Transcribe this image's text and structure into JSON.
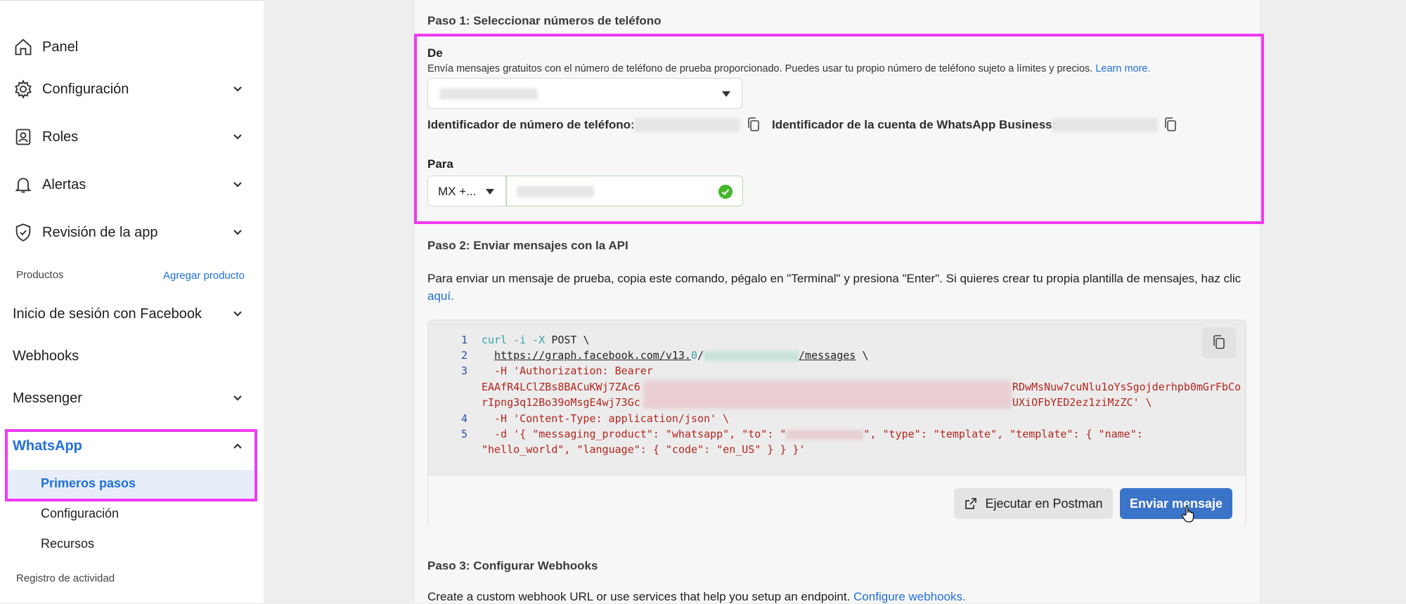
{
  "sidebar": {
    "panel": "Panel",
    "configuracion": "Configuración",
    "roles": "Roles",
    "alertas": "Alertas",
    "revision": "Revisión de la app",
    "productos": "Productos",
    "agregar_producto": "Agregar producto",
    "inicio_sesion": "Inicio de sesión con Facebook",
    "webhooks": "Webhooks",
    "messenger": "Messenger",
    "whatsapp": "WhatsApp",
    "primeros_pasos": "Primeros pasos",
    "wa_configuracion": "Configuración",
    "recursos": "Recursos",
    "registro": "Registro de actividad"
  },
  "step1": {
    "title": "Paso 1: Seleccionar números de teléfono",
    "de_label": "De",
    "de_desc": "Envía mensajes gratuitos con el número de teléfono de prueba proporcionado. Puedes usar tu propio número de teléfono sujeto a límites y precios.",
    "learn_more": "Learn more.",
    "phone_id_label": "Identificador de número de teléfono:",
    "waba_id_label": "Identificador de la cuenta de WhatsApp Business:",
    "para_label": "Para",
    "country_code": "MX +..."
  },
  "step2": {
    "title": "Paso 2: Enviar mensajes con la API",
    "desc": "Para enviar un mensaje de prueba, copia este comando, pégalo en \"Terminal\" y presiona \"Enter\". Si quieres crear tu propia plantilla de mensajes, haz clic",
    "aqui": "aquí.",
    "code": {
      "line_numbers": [
        "1",
        "2",
        "3",
        "4",
        "5"
      ],
      "l1_a": "curl -i -X ",
      "l1_b": "POST \\",
      "l2_a": "https://graph.facebook.com/v13.",
      "l2_b": "0",
      "l2_c": "/",
      "l2_d": "/messages",
      "l2_e": " \\",
      "l3": "-H 'Authorization: Bearer",
      "l3b_left": "EAAfR4LClZBs8BACuKWj7ZAc6",
      "l3b_right": "RDwMsNuw7cuNlu1oYsSgojderhpb0mGrFbCo",
      "l3c_left": "rIpng3q12Bo39oMsgE4wj73Gc",
      "l3c_right": "UXiOFbYED2ez1ziMzZC' \\",
      "l4": "-H 'Content-Type: application/json' \\",
      "l5_a": "-d '{ \"messaging_product\": \"whatsapp\", \"to\": \"",
      "l5_b": "\", \"type\": \"template\", \"template\": { \"name\":",
      "l6": "\"hello_world\", \"language\": { \"code\": \"en_US\" } } }'"
    },
    "postman_label": "Ejecutar en Postman",
    "send_label": "Enviar mensaje"
  },
  "step3": {
    "title": "Paso 3: Configurar Webhooks",
    "desc": "Create a custom webhook URL or use services that help you setup an endpoint.",
    "link": "Configure webhooks."
  },
  "colors": {
    "highlight": "#f23af2",
    "link": "#216fdb",
    "primary_button": "#3b73c9"
  }
}
